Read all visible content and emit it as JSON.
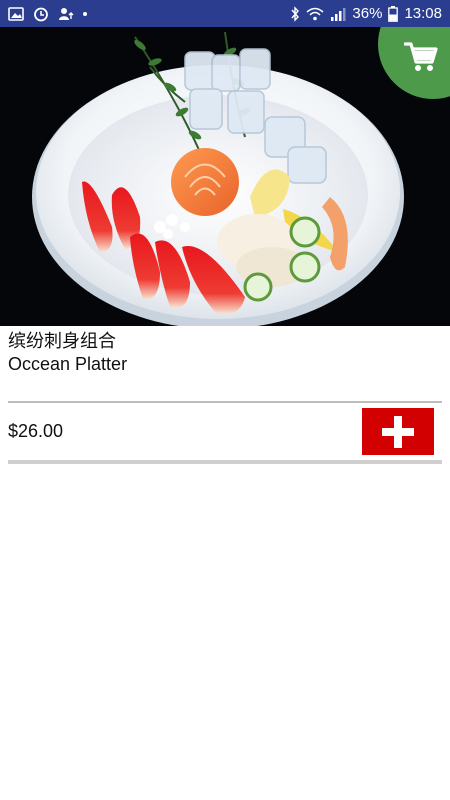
{
  "status_bar": {
    "battery_percent": "36%",
    "time": "13:08",
    "left_icons": [
      "image-icon",
      "timer-icon",
      "person-upload-icon",
      "dot-icon"
    ],
    "right_icons": [
      "bluetooth-icon",
      "wifi-icon",
      "signal-icon",
      "battery-icon"
    ]
  },
  "hero": {
    "subject": "sashimi platter in white bowl",
    "cart_button_icon": "cart-icon",
    "cart_button_color": "#4c9a4a"
  },
  "product": {
    "name_zh": "缤纷刺身组合",
    "name_en": "Occean Platter",
    "price": "$26.00",
    "add_button_icon": "plus-icon",
    "add_button_color": "#d20000"
  },
  "colors": {
    "status_bar": "#2a3d8f",
    "hero_background": "#05060a"
  }
}
